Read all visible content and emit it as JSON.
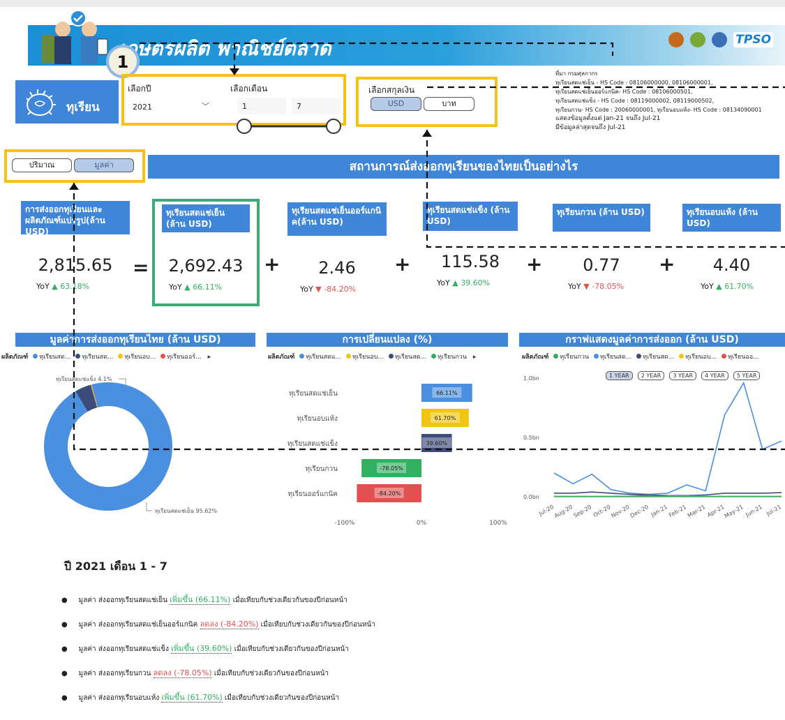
{
  "header": {
    "title": "เกษตรผลิต พาณิชย์ตลาด",
    "tps_logo": "TPSO",
    "step_badge": "1"
  },
  "product": {
    "label": "ทุเรียน"
  },
  "filters": {
    "year_label": "เลือกปี",
    "year_value": "2021",
    "month_label": "เลือกเดือน",
    "month_from": "1",
    "month_to": "7",
    "currency_label": "เลือกสกุลเงิน",
    "currency_usd": "USD",
    "currency_thb": "บาท",
    "mode_quantity": "ปริมาณ",
    "mode_value": "มูลค่า"
  },
  "source": {
    "title": "ที่มา กรมศุลกากร",
    "lines": [
      "ทุเรียนสดแช่เย็น - HS Code : 08106000000, 08106000001,",
      "ทุเรียนสดแช่เย็นออร์แกนิค- HS Code : 08106000501,",
      "ทุเรียนสดแช่แข็ง - HS Code : 08119000002, 08119000502,",
      "ทุเรียนกวน- HS Code : 20060000001, ทุเรียนอบแห้ง- HS Code : 08134090001"
    ],
    "range": "แสดงข้อมูลตั้งแต่ Jan-21 จนถึง Jul-21",
    "latest": "มีข้อมูลล่าสุดจนถึง Jul-21"
  },
  "section_title": "สถานการณ์ส่งออกทุเรียนของไทยเป็นอย่างไร",
  "kpis": [
    {
      "title": "การส่งออกทุเรียนและผลิตภัณฑ์แปรรูป(ล้าน USD)",
      "value": "2,815.65",
      "yoy_label": "YoY",
      "yoy": "63.18%",
      "dir": "up"
    },
    {
      "title": "ทุเรียนสดแช่เย็น (ล้าน USD)",
      "value": "2,692.43",
      "yoy_label": "YoY",
      "yoy": "66.11%",
      "dir": "up"
    },
    {
      "title": "ทุเรียนสดแช่เย็นออร์แกนิค(ล้าน USD)",
      "value": "2.46",
      "yoy_label": "YoY",
      "yoy": "-84.20%",
      "dir": "down"
    },
    {
      "title": "ทุเรียนสดแช่แข็ง (ล้าน USD)",
      "value": "115.58",
      "yoy_label": "YoY",
      "yoy": "39.60%",
      "dir": "up"
    },
    {
      "title": "ทุเรียนกวน (ล้าน USD)",
      "value": "0.77",
      "yoy_label": "YoY",
      "yoy": "-78.05%",
      "dir": "down"
    },
    {
      "title": "ทุเรียนอบแห้ง (ล้าน USD)",
      "value": "4.40",
      "yoy_label": "YoY",
      "yoy": "61.70%",
      "dir": "up"
    }
  ],
  "operators": {
    "eq": "=",
    "plus": "+"
  },
  "colors": {
    "primary": "#3f86d8",
    "highlight": "#f6c21a",
    "up": "#30b060",
    "down": "#e05252"
  },
  "legend_prefix": "ผลิตภัณฑ์",
  "chart_data": [
    {
      "type": "pie",
      "title": "มูลค่าการส่งออกทุเรียนไทย (ล้าน USD)",
      "legend": [
        "ทุเรียนสด...",
        "ทุเรียนสด...",
        "ทุเรียนอบ...",
        "ทุเรียนออร์..."
      ],
      "legend_colors": [
        "#4a8fe0",
        "#3c4c7a",
        "#f2c413",
        "#e05252"
      ],
      "slices": [
        {
          "label": "ทุเรียนสดแช่เย็น 95.62%",
          "value": 95.62,
          "color": "#4a8fe0"
        },
        {
          "label": "ทุเรียนสดแช่แข็ง 4.1%",
          "value": 4.1,
          "color": "#3c4c7a"
        },
        {
          "label": "",
          "value": 0.16,
          "color": "#f2c413"
        },
        {
          "label": "",
          "value": 0.09,
          "color": "#e05252"
        },
        {
          "label": "",
          "value": 0.03,
          "color": "#30b060"
        }
      ]
    },
    {
      "type": "bar",
      "title": "การเปลี่ยนแปลง (%)",
      "legend": [
        "ทุเรียนสดแ...",
        "ทุเรียนอบ...",
        "ทุเรียนสด...",
        "ทุเรียนกวน"
      ],
      "legend_colors": [
        "#4a8fe0",
        "#f2c413",
        "#3c4c7a",
        "#30b060"
      ],
      "categories": [
        "ทุเรียนสดแช่เย็น",
        "ทุเรียนอบแห้ง",
        "ทุเรียนสดแช่แข็ง",
        "ทุเรียนกวน",
        "ทุเรียนออร์แกนิค"
      ],
      "values": [
        66.11,
        61.7,
        39.6,
        -78.05,
        -84.2
      ],
      "value_labels": [
        "66.11%",
        "61.70%",
        "39.60%",
        "-78.05%",
        "-84.20%"
      ],
      "bar_colors": [
        "#4a8fe0",
        "#f2c413",
        "#3c4c7a",
        "#30b060",
        "#e05252"
      ],
      "xlim": [
        -100,
        100
      ],
      "xticks": [
        "-100%",
        "0%",
        "100%"
      ]
    },
    {
      "type": "line",
      "title": "กราฟแสดงมูลค่าการส่งออก (ล้าน USD)",
      "legend": [
        "ทุเรียนกวน",
        "ทุเรียนสด...",
        "ทุเรียนสด...",
        "ทุเรียนอบ...",
        "ทุเรียนออ..."
      ],
      "legend_colors": [
        "#30b060",
        "#4a8fe0",
        "#3c4c7a",
        "#f2c413",
        "#e05252"
      ],
      "period_buttons": [
        "1 YEAR",
        "2 YEAR",
        "3 YEAR",
        "4 YEAR",
        "5 YEAR"
      ],
      "active_period": "1 YEAR",
      "x": [
        "Jul-20",
        "Aug-20",
        "Sep-20",
        "Oct-20",
        "Nov-20",
        "Dec-20",
        "Jan-21",
        "Feb-21",
        "Mar-21",
        "Apr-21",
        "May-21",
        "Jun-21",
        "Jul-21"
      ],
      "yticks": [
        "1.0bn",
        "0.5bn",
        "0.0bn"
      ],
      "ylim": [
        0,
        1.0
      ],
      "series": [
        {
          "color": "#4a8fe0",
          "values": [
            0.2,
            0.11,
            0.19,
            0.06,
            0.03,
            0.02,
            0.03,
            0.1,
            0.05,
            0.69,
            0.96,
            0.4,
            0.47
          ]
        },
        {
          "color": "#3c4c7a",
          "values": [
            0.03,
            0.03,
            0.04,
            0.03,
            0.02,
            0.015,
            0.01,
            0.01,
            0.015,
            0.03,
            0.03,
            0.03,
            0.035
          ]
        },
        {
          "color": "#f2c413",
          "values": [
            0.005,
            0.005,
            0.005,
            0.005,
            0.005,
            0.005,
            0.005,
            0.005,
            0.005,
            0.005,
            0.005,
            0.005,
            0.005
          ]
        },
        {
          "color": "#e05252",
          "values": [
            0.002,
            0.002,
            0.002,
            0.002,
            0.004,
            0.01,
            0.003,
            0.002,
            0.002,
            0.002,
            0.002,
            0.002,
            0.002
          ]
        },
        {
          "color": "#30b060",
          "values": [
            0.001,
            0.001,
            0.001,
            0.001,
            0.001,
            0.001,
            0.001,
            0.001,
            0.001,
            0.001,
            0.001,
            0.001,
            0.001
          ]
        }
      ]
    }
  ],
  "summary": {
    "title": "ปี 2021 เดือน 1 - 7",
    "items": [
      {
        "pre": "มูลค่า ส่งออกทุเรียนสดแช่เย็น ",
        "tag": "เพิ่มขึ้น (66.11%)",
        "dir": "up",
        "post": " เมื่อเทียบกับช่วงเดียวกันของปีก่อนหน้า"
      },
      {
        "pre": "มูลค่า ส่งออกทุเรียนสดแช่เย็นออร์แกนิค ",
        "tag": "ลดลง (-84.20%)",
        "dir": "down",
        "post": " เมื่อเทียบกับช่วงเดียวกันของปีก่อนหน้า"
      },
      {
        "pre": "มูลค่า ส่งออกทุเรียนสดแช่แข็ง ",
        "tag": "เพิ่มขึ้น (39.60%)",
        "dir": "up",
        "post": " เมื่อเทียบกับช่วงเดียวกันของปีก่อนหน้า"
      },
      {
        "pre": "มูลค่า ส่งออกทุเรียนกวน ",
        "tag": "ลดลง (-78.05%)",
        "dir": "down",
        "post": " เมื่อเทียบกับช่วงเดียวกันของปีก่อนหน้า"
      },
      {
        "pre": "มูลค่า ส่งออกทุเรียนอบแห้ง ",
        "tag": "เพิ่มขึ้น (61.70%)",
        "dir": "up",
        "post": " เมื่อเทียบกับช่วงเดียวกันของปีก่อนหน้า"
      }
    ]
  }
}
